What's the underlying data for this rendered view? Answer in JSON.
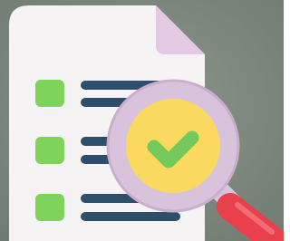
{
  "illustration": {
    "subject": "checklist-audit-icon",
    "colors": {
      "background": "#7E8A80",
      "paper": "#F5F3F4",
      "paper_fold": "#E3C9E1",
      "checkbox": "#7ED35B",
      "line": "#2F4E6C",
      "lens_ring": "#D9C2DC",
      "lens_glass": "#FBD860",
      "check_mark": "#74C95A",
      "handle": "#E8404D",
      "handle_highlight": "#F36C74"
    },
    "rows": [
      {
        "checked": true
      },
      {
        "checked": true
      },
      {
        "checked": true
      }
    ]
  }
}
